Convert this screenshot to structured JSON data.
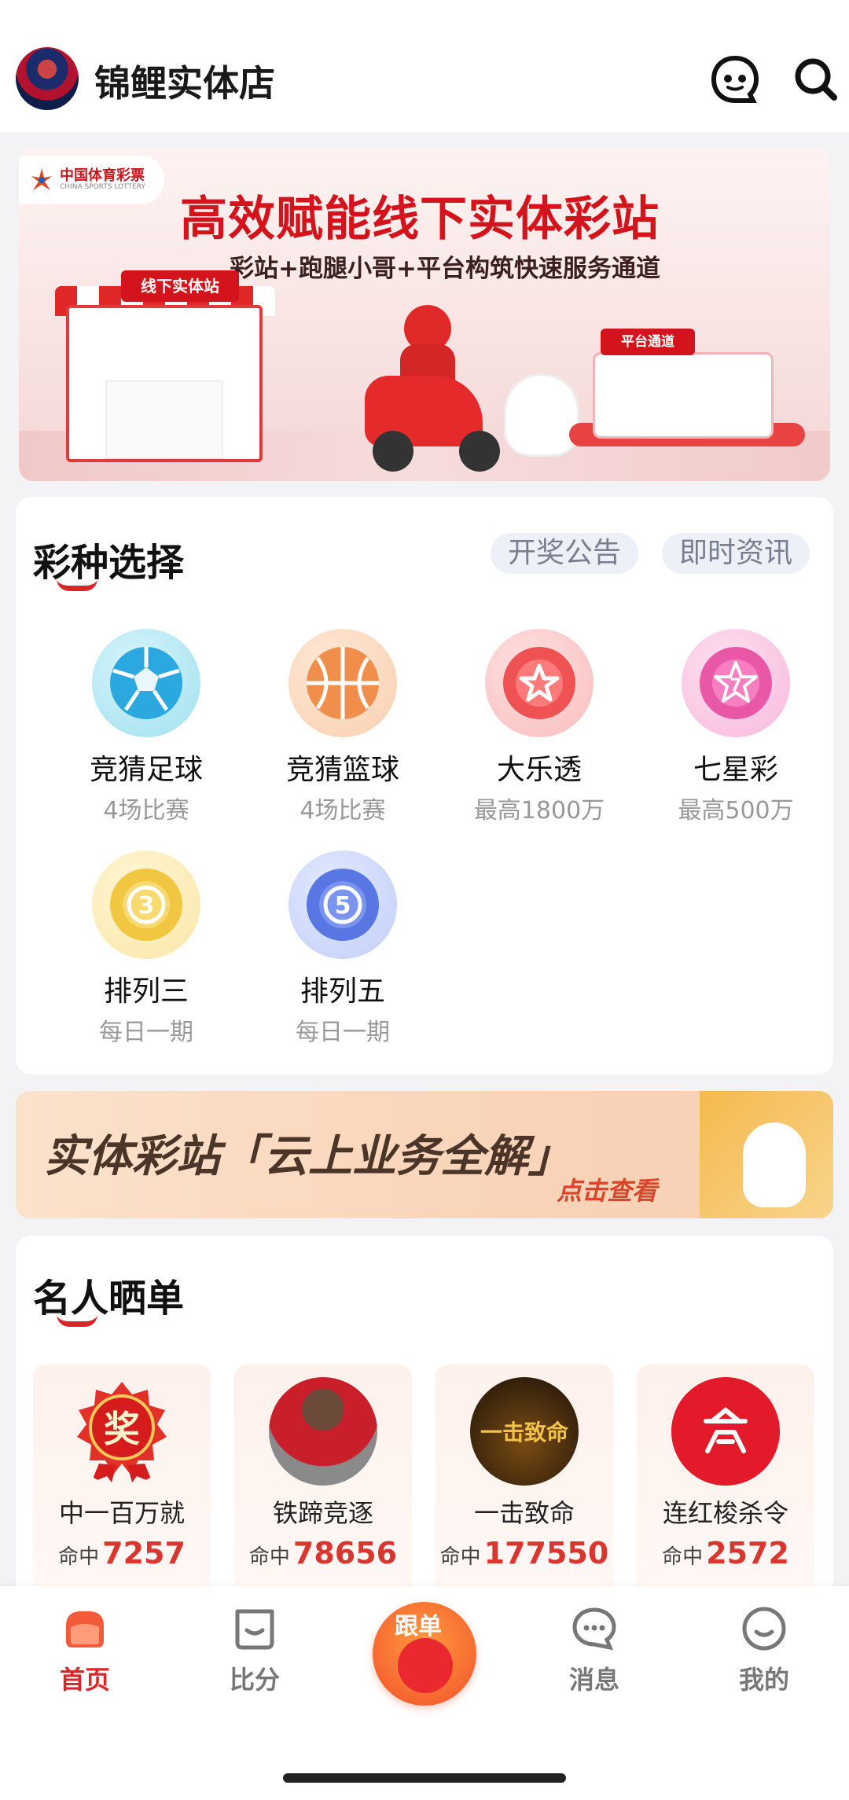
{
  "header": {
    "store_name": "锦鲤实体店"
  },
  "banner": {
    "logo_text": "中国体育彩票",
    "logo_subtext": "CHINA SPORTS LOTTERY",
    "title": "高效赋能线下实体彩站",
    "subtitle": "彩站+跑腿小哥+平台构筑快速服务通道",
    "kiosk_sign": "线下实体站",
    "platform_sign": "平台通道"
  },
  "lottery": {
    "title": "彩种选择",
    "notice_label": "开奖公告",
    "news_label": "即时资讯",
    "games": [
      {
        "name": "竞猜足球",
        "sub": "4场比赛",
        "icon": "football-icon",
        "color": "#3bb6e8"
      },
      {
        "name": "竞猜篮球",
        "sub": "4场比赛",
        "icon": "basketball-icon",
        "color": "#f39a5e"
      },
      {
        "name": "大乐透",
        "sub": "最高1800万",
        "icon": "star-ball-icon",
        "color": "#ef5a5a"
      },
      {
        "name": "七星彩",
        "sub": "最高500万",
        "icon": "seven-star-icon",
        "color": "#ec5ca8"
      },
      {
        "name": "排列三",
        "sub": "每日一期",
        "icon": "number-3-icon",
        "color": "#f0c53e"
      },
      {
        "name": "排列五",
        "sub": "每日一期",
        "icon": "number-5-icon",
        "color": "#5a7de6"
      }
    ]
  },
  "promo": {
    "title": "实体彩站「云上业务全解」",
    "link": "点击查看"
  },
  "celebrities": {
    "title": "名人晒单",
    "hit_label": "命中",
    "items": [
      {
        "name": "中一百万就",
        "hits": "7257",
        "avatar_text": "奖"
      },
      {
        "name": "铁蹄竞逐",
        "hits": "78656",
        "avatar_text": ""
      },
      {
        "name": "一击致命",
        "hits": "177550",
        "avatar_text": "一击致命"
      },
      {
        "name": "连红梭杀令",
        "hits": "2572",
        "avatar_text": ""
      }
    ]
  },
  "nav": {
    "home": "首页",
    "score": "比分",
    "follow": "跟单",
    "messages": "消息",
    "mine": "我的"
  },
  "colors": {
    "accent": "#d9262b",
    "hit_number": "#d8362e",
    "pill_bg": "#eef0f7"
  }
}
